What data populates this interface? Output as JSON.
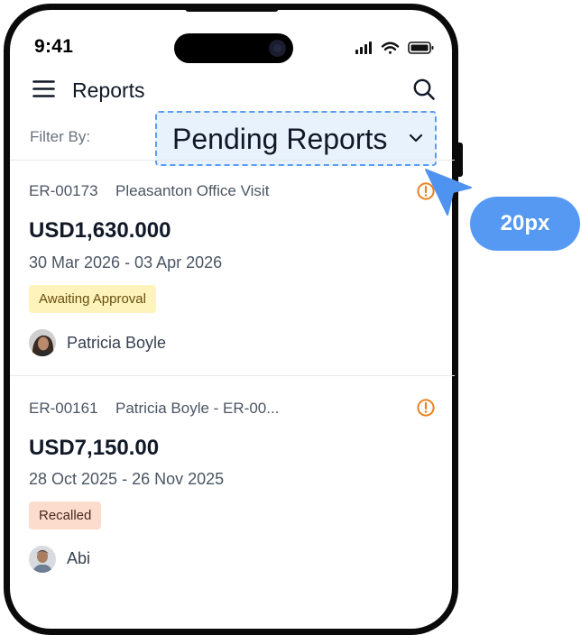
{
  "status_bar": {
    "time": "9:41"
  },
  "header": {
    "title": "Reports"
  },
  "filter": {
    "label": "Filter By:",
    "value": "Pending Reports"
  },
  "reports": [
    {
      "id": "ER-00173",
      "name": "Pleasanton Office Visit",
      "amount": "USD1,630.000",
      "dates": "30 Mar 2026 - 03 Apr 2026",
      "status": "Awaiting Approval",
      "submitter": "Patricia Boyle"
    },
    {
      "id": "ER-00161",
      "name": "Patricia Boyle - ER-00...",
      "amount": "USD7,150.00",
      "dates": "28 Oct 2025 - 26 Nov 2025",
      "status": "Recalled",
      "submitter": "Abi"
    }
  ],
  "annotation": {
    "label": "20px"
  },
  "colors": {
    "accent": "#5599f2",
    "warning": "#e8821e",
    "awaiting_bg": "#fdf3bb",
    "recalled_bg": "#fbdccd"
  },
  "icons": [
    "menu-icon",
    "search-icon",
    "chevron-down-icon",
    "warning-icon",
    "cursor-arrow-icon",
    "signal-icon",
    "wifi-icon",
    "battery-icon"
  ]
}
